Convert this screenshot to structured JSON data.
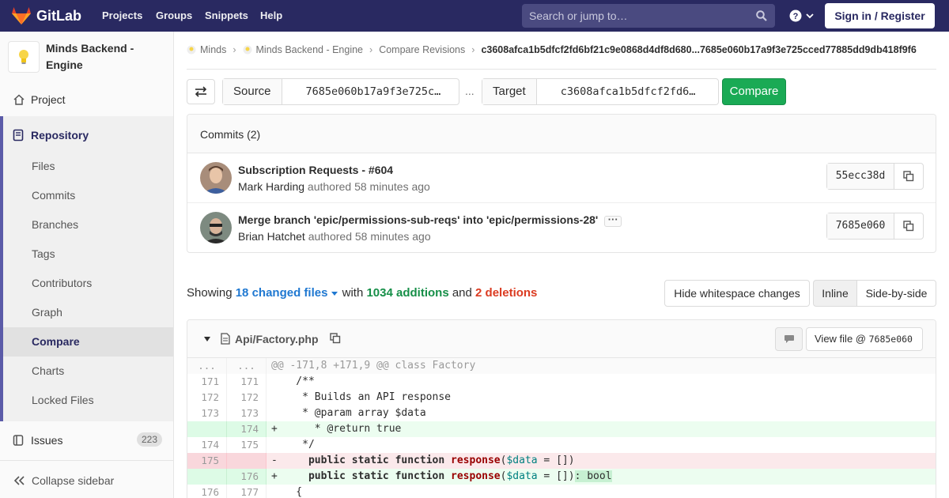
{
  "topbar": {
    "brand": "GitLab",
    "nav": [
      "Projects",
      "Groups",
      "Snippets",
      "Help"
    ],
    "search_placeholder": "Search or jump to…",
    "signin_label": "Sign in / Register"
  },
  "sidebar": {
    "project_name": "Minds Backend - Engine",
    "project_label": "Project",
    "repository_label": "Repository",
    "repo_items": [
      "Files",
      "Commits",
      "Branches",
      "Tags",
      "Contributors",
      "Graph",
      "Compare",
      "Charts",
      "Locked Files"
    ],
    "active_item": "Compare",
    "issues_label": "Issues",
    "issues_count": "223",
    "collapse_label": "Collapse sidebar"
  },
  "breadcrumb": {
    "items": [
      "Minds",
      "Minds Backend - Engine",
      "Compare Revisions"
    ],
    "current": "c3608afca1b5dfcf2fd6bf21c9e0868d4df8d680...7685e060b17a9f3e725cced77885dd9db418f9f6"
  },
  "compare": {
    "source_label": "Source",
    "source_value": "7685e060b17a9f3e725c…",
    "separator": "...",
    "target_label": "Target",
    "target_value": "c3608afca1b5dfcf2fd6…",
    "button_label": "Compare"
  },
  "commits": {
    "header": "Commits (2)",
    "items": [
      {
        "title": "Subscription Requests - #604",
        "author": "Mark Harding",
        "meta": "authored 58 minutes ago",
        "sha": "55ecc38d"
      },
      {
        "title": "Merge branch 'epic/permissions-sub-reqs' into 'epic/permissions-28'",
        "author": "Brian Hatchet",
        "meta": "authored 58 minutes ago",
        "sha": "7685e060"
      }
    ]
  },
  "summary": {
    "showing": "Showing",
    "changed_files": "18 changed files",
    "with": "with",
    "additions": "1034 additions",
    "and": "and",
    "deletions": "2 deletions"
  },
  "view_buttons": {
    "whitespace": "Hide whitespace changes",
    "inline": "Inline",
    "side_by_side": "Side-by-side"
  },
  "file": {
    "name": "Api/Factory.php",
    "view_file_prefix": "View file @ ",
    "view_file_sha": "7685e060"
  },
  "diff_lines": [
    {
      "type": "match",
      "old": "...",
      "new": "...",
      "text": "@@ -171,8 +171,9 @@ class Factory"
    },
    {
      "type": "ctx",
      "old": "171",
      "new": "171",
      "text": "    /**"
    },
    {
      "type": "ctx",
      "old": "172",
      "new": "172",
      "text": "     * Builds an API response"
    },
    {
      "type": "ctx",
      "old": "173",
      "new": "173",
      "text": "     * @param array $data"
    },
    {
      "type": "add",
      "old": "",
      "new": "174",
      "text": "+      * @return true"
    },
    {
      "type": "ctx",
      "old": "174",
      "new": "175",
      "text": "     */"
    },
    {
      "type": "del",
      "old": "175",
      "new": "",
      "text": "-     public static function response($data = [])"
    },
    {
      "type": "add",
      "old": "",
      "new": "176",
      "text": "+     public static function response($data = []): bool"
    },
    {
      "type": "ctx",
      "old": "176",
      "new": "177",
      "text": "    {"
    }
  ],
  "colors": {
    "topbar": "#292961",
    "accent_green": "#1aaa55",
    "link_blue": "#1f78d1",
    "deletions_red": "#db3b21"
  },
  "icons": [
    "gitlab-logo-icon",
    "search-icon",
    "help-icon",
    "chevron-down-icon",
    "home-icon",
    "book-icon",
    "issues-icon",
    "collapse-icon",
    "swap-icon",
    "copy-icon",
    "file-icon",
    "comment-icon",
    "caret-down-icon"
  ]
}
